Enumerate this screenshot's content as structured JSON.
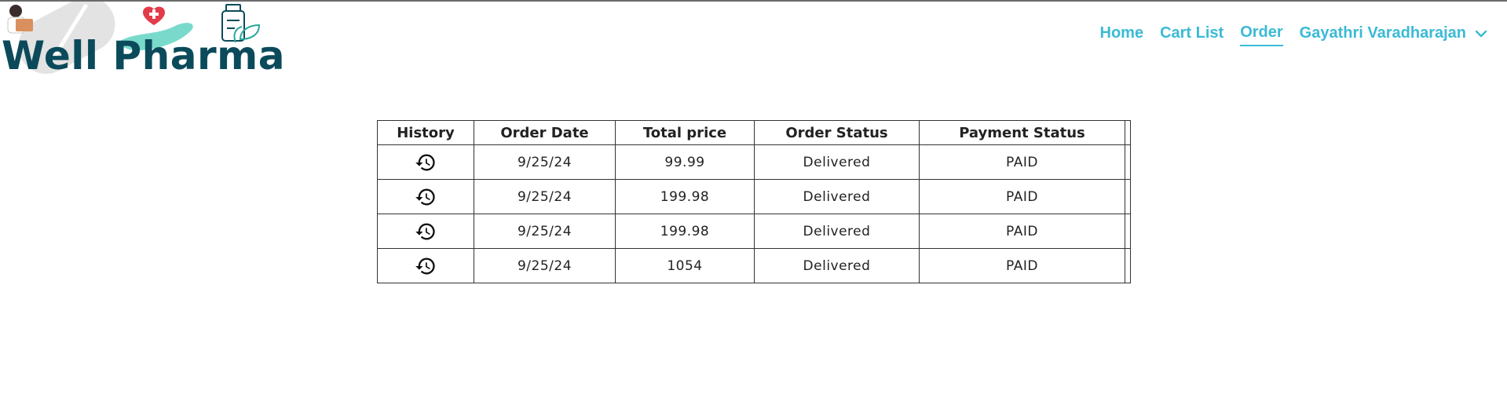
{
  "brand": {
    "name": "Well Pharma"
  },
  "nav": {
    "items": [
      {
        "label": "Home",
        "active": false
      },
      {
        "label": "Cart List",
        "active": false
      },
      {
        "label": "Order",
        "active": true
      }
    ],
    "user_name": "Gayathri Varadharajan",
    "accent_color": "#3bbad6"
  },
  "orders_table": {
    "headers": [
      "History",
      "Order Date",
      "Total price",
      "Order Status",
      "Payment Status"
    ],
    "rows": [
      {
        "history_icon": "history-icon",
        "date": "9/25/24",
        "total": "99.99",
        "status": "Delivered",
        "payment": "PAID"
      },
      {
        "history_icon": "history-icon",
        "date": "9/25/24",
        "total": "199.98",
        "status": "Delivered",
        "payment": "PAID"
      },
      {
        "history_icon": "history-icon",
        "date": "9/25/24",
        "total": "199.98",
        "status": "Delivered",
        "payment": "PAID"
      },
      {
        "history_icon": "history-icon",
        "date": "9/25/24",
        "total": "1054",
        "status": "Delivered",
        "payment": "PAID"
      }
    ]
  }
}
